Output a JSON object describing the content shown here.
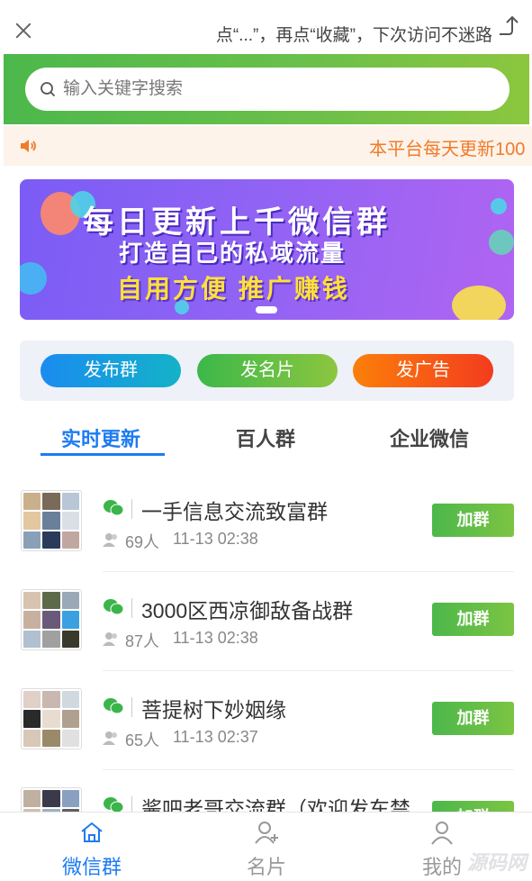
{
  "header": {
    "hint_text": "点“...”，再点“收藏”，下次访问不迷路"
  },
  "search": {
    "placeholder": "输入关键字搜索"
  },
  "notice": {
    "text": "本平台每天更新100"
  },
  "banner": {
    "line1": "每日更新上千微信群",
    "line2": "打造自己的私域流量",
    "line3": "自用方便  推广赚钱"
  },
  "actions": {
    "publish_group": "发布群",
    "publish_card": "发名片",
    "publish_ad": "发广告"
  },
  "tabs": [
    {
      "label": "实时更新",
      "active": true
    },
    {
      "label": "百人群",
      "active": false
    },
    {
      "label": "企业微信",
      "active": false
    }
  ],
  "groups": [
    {
      "title": "一手信息交流致富群",
      "members": "69人",
      "time": "11-13 02:38",
      "join_label": "加群"
    },
    {
      "title": "3000区西凉御敌备战群",
      "members": "87人",
      "time": "11-13 02:38",
      "join_label": "加群"
    },
    {
      "title": "菩提树下妙姻缘",
      "members": "65人",
      "time": "11-13 02:37",
      "join_label": "加群"
    },
    {
      "title": "酱吧老哥交流群（欢迎发车禁…",
      "members": "",
      "time": "",
      "join_label": "加群"
    }
  ],
  "bottom_nav": [
    {
      "label": "微信群",
      "icon": "home-icon",
      "active": true
    },
    {
      "label": "名片",
      "icon": "add-user-icon",
      "active": false
    },
    {
      "label": "我的",
      "icon": "user-icon",
      "active": false
    }
  ],
  "watermark": "源码网",
  "colors": {
    "accent_blue": "#1d7bf2",
    "brand_green": "#4cb84b",
    "notice_orange": "#f07b2a"
  }
}
